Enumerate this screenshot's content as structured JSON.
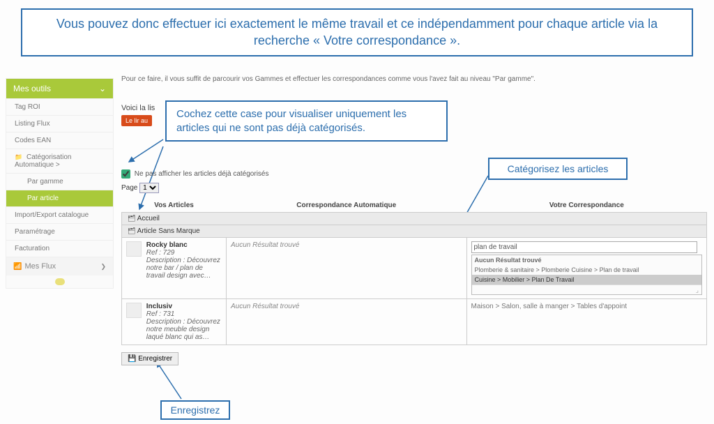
{
  "callouts": {
    "top": "Vous pouvez donc effectuer ici exactement le même travail et ce indépendamment pour chaque article via la recherche « Votre correspondance ».",
    "check": "Cochez cette case pour visualiser uniquement les articles qui ne sont pas déjà catégorisés.",
    "categorize": "Catégorisez les articles",
    "save": "Enregistrez"
  },
  "sidebar": {
    "tools_header": "Mes outils",
    "items": {
      "tag": "Tag ROI",
      "listing": "Listing Flux",
      "codes": "Codes EAN",
      "cat_auto": "Catégorisation Automatique >",
      "par_gamme": "Par gamme",
      "par_article": "Par article",
      "import": "Import/Export catalogue",
      "param": "Paramétrage",
      "fact": "Facturation"
    },
    "flux_header": "Mes Flux"
  },
  "main": {
    "instruction": "Pour ce faire, il vous suffit de parcourir vos Gammes et effectuer les correspondances comme vous l'avez fait au niveau \"Par gamme\".",
    "list_intro": "Voici la lis",
    "orange_btn": "Le lir au",
    "checkbox_label": "Ne pas afficher les articles déjà catégorisés",
    "page_label": "Page",
    "page_value": "1",
    "cols": {
      "articles": "Vos Articles",
      "auto": "Correspondance Automatique",
      "your": "Votre Correspondance"
    },
    "groups": {
      "accueil": "Accueil",
      "sans_marque": "Article Sans Marque"
    },
    "rows": [
      {
        "title": "Rocky blanc",
        "ref": "Ref : 729",
        "desc": "Description : Découvrez notre bar / plan de travail design avec…",
        "auto": "Aucun Résultat trouvé",
        "input": "plan de travail",
        "suggest_header": "Aucun Résultat trouvé",
        "suggest1": "Plomberie & sanitaire > Plomberie Cuisine > Plan de travail",
        "suggest2": "Cuisine > Mobilier > Plan De Travail"
      },
      {
        "title": "Inclusiv",
        "ref": "Ref : 731",
        "desc": "Description : Découvrez notre meuble design laqué blanc qui as…",
        "auto": "Aucun Résultat trouvé",
        "your": "Maison > Salon, salle à manger > Tables d'appoint"
      }
    ],
    "save_btn": "Enregistrer"
  }
}
